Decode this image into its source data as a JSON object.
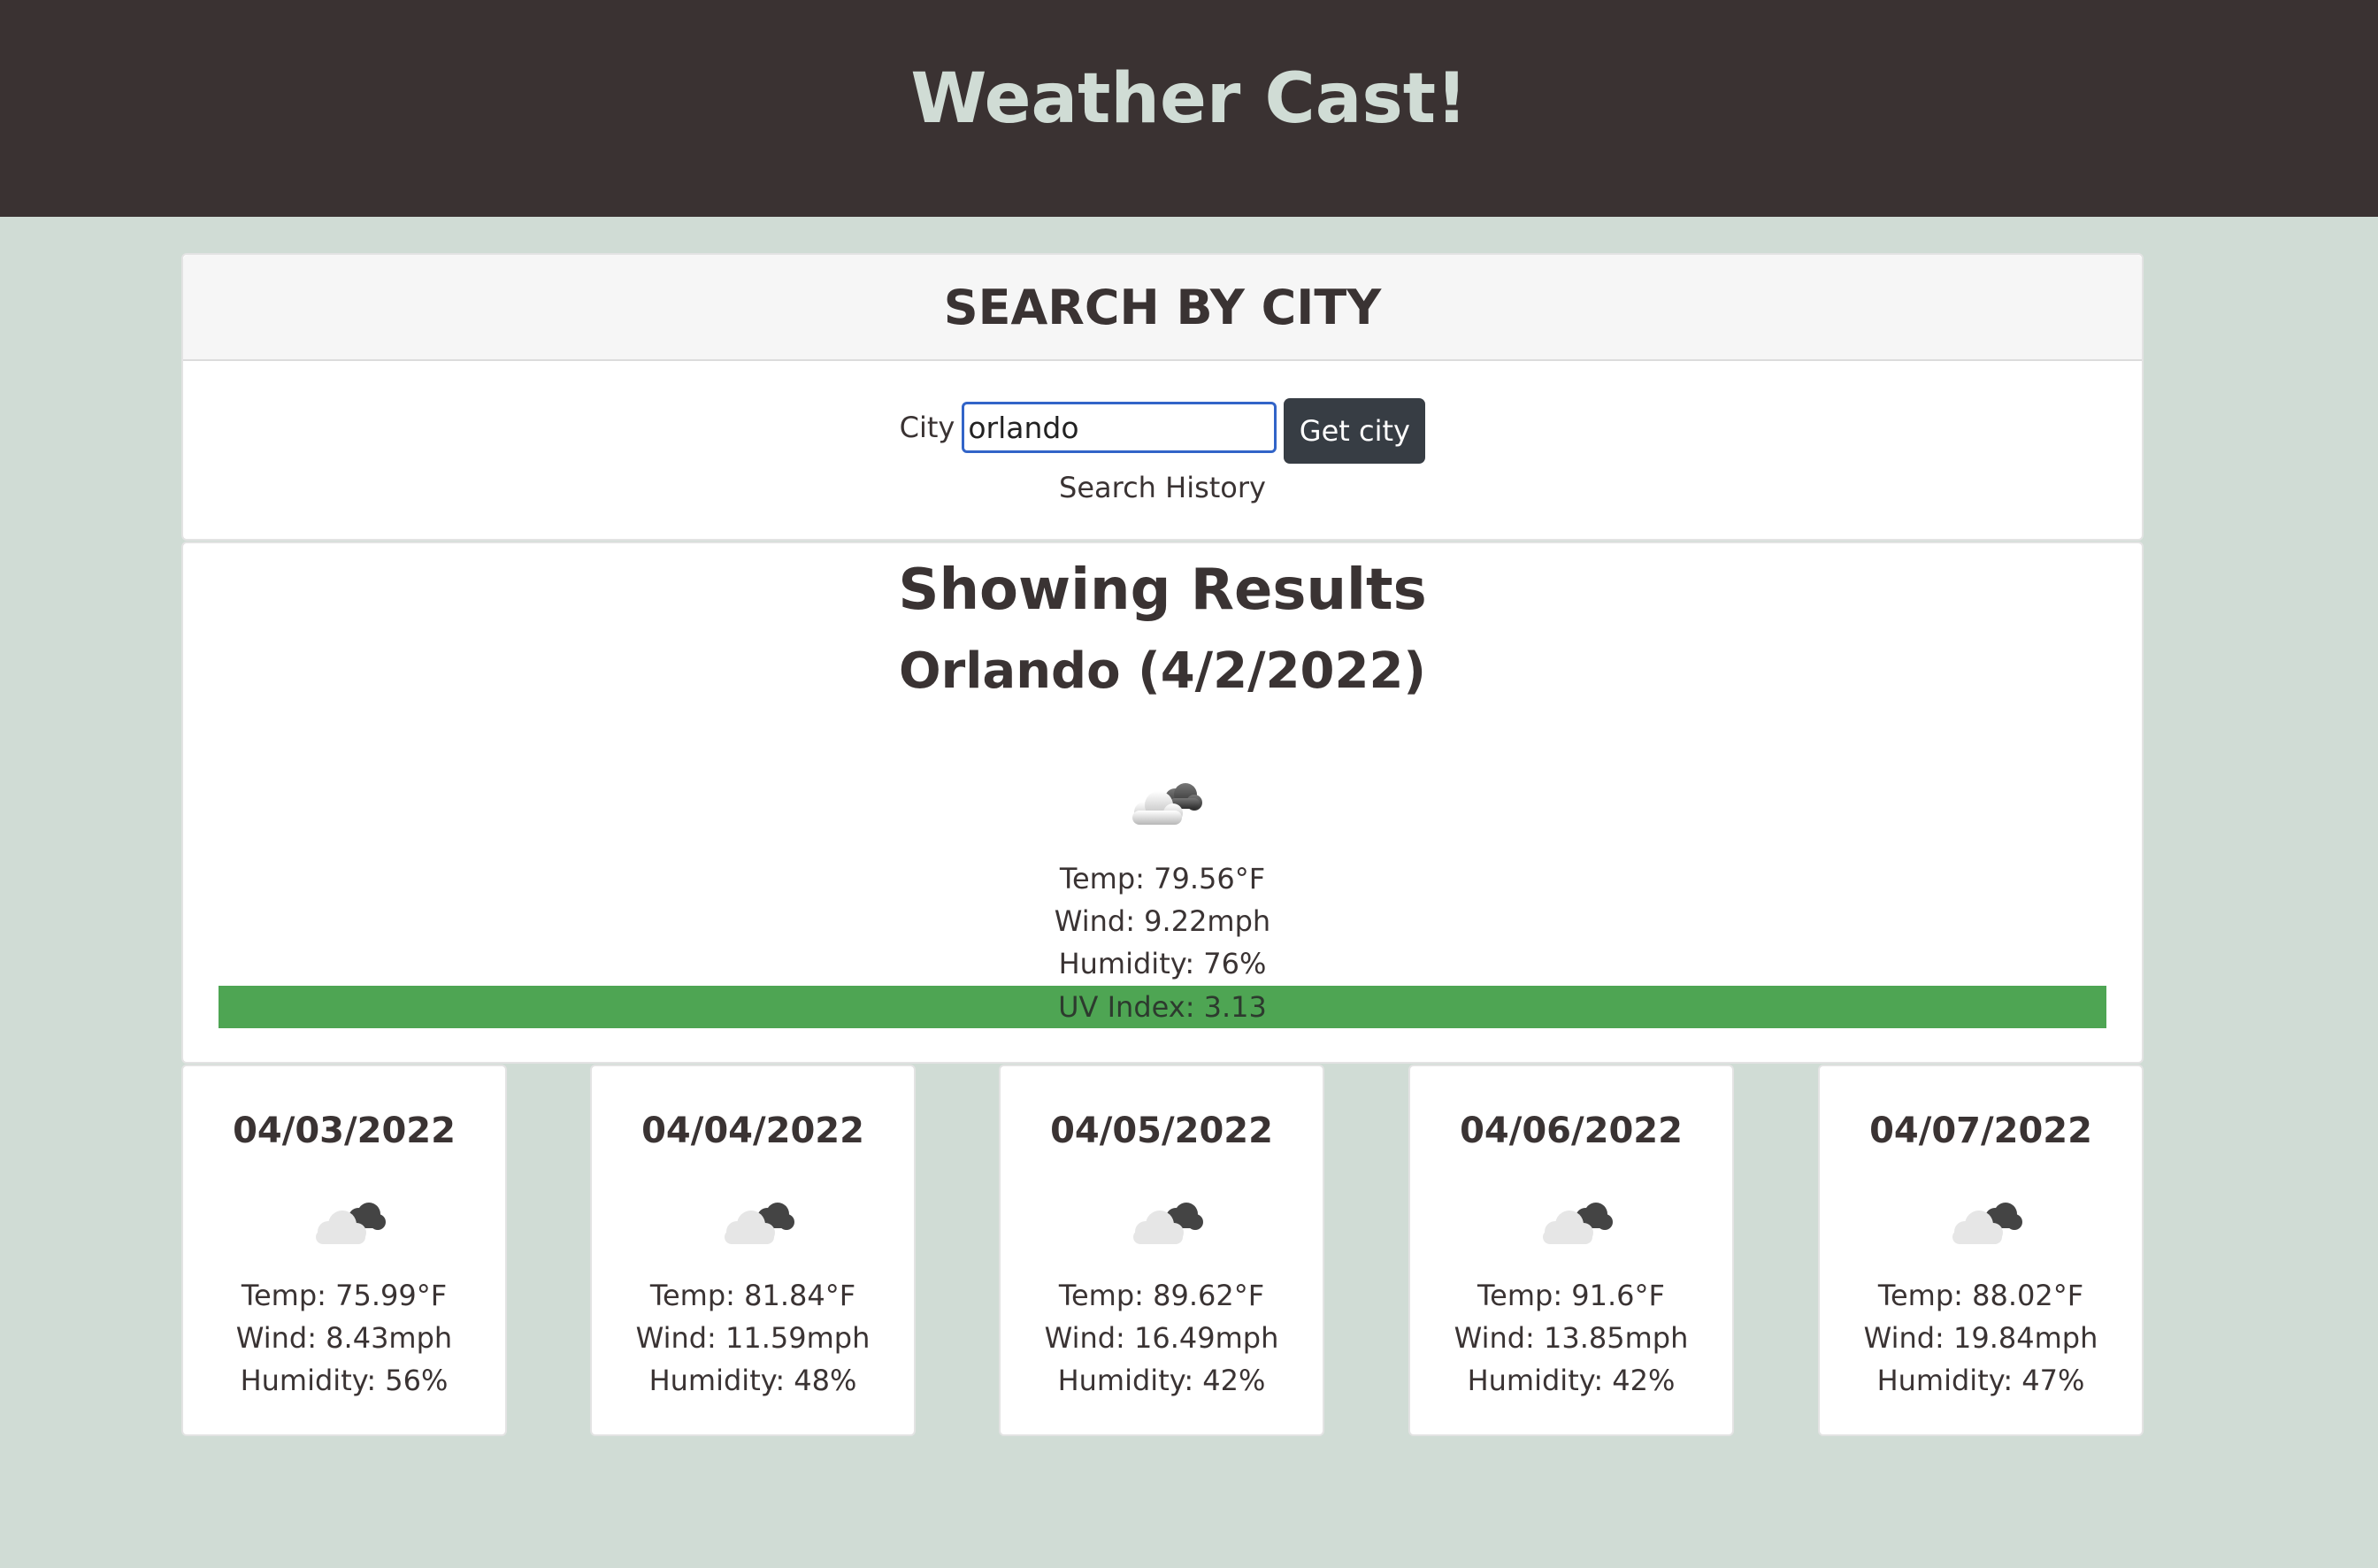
{
  "app": {
    "title": "Weather Cast!"
  },
  "search": {
    "header": "SEARCH BY CITY",
    "city_label": "City",
    "city_value": "orlando",
    "button_label": "Get city",
    "history_label": "Search History"
  },
  "results": {
    "heading": "Showing Results",
    "city_date": "Orlando (4/2/2022)",
    "icon": "partly-cloudy-icon",
    "temp": "Temp: 79.56°F",
    "wind": "Wind: 9.22mph",
    "humidity": "Humidity: 76%",
    "uv": "UV Index: 3.13",
    "uv_color": "#4ea553"
  },
  "forecast": [
    {
      "date": "04/03/2022",
      "icon": "partly-cloudy-icon",
      "temp": "Temp: 75.99°F",
      "wind": "Wind: 8.43mph",
      "humidity": "Humidity: 56%"
    },
    {
      "date": "04/04/2022",
      "icon": "partly-cloudy-icon",
      "temp": "Temp: 81.84°F",
      "wind": "Wind: 11.59mph",
      "humidity": "Humidity: 48%"
    },
    {
      "date": "04/05/2022",
      "icon": "partly-cloudy-icon",
      "temp": "Temp: 89.62°F",
      "wind": "Wind: 16.49mph",
      "humidity": "Humidity: 42%"
    },
    {
      "date": "04/06/2022",
      "icon": "partly-cloudy-icon",
      "temp": "Temp: 91.6°F",
      "wind": "Wind: 13.85mph",
      "humidity": "Humidity: 42%"
    },
    {
      "date": "04/07/2022",
      "icon": "partly-cloudy-icon",
      "temp": "Temp: 88.02°F",
      "wind": "Wind: 19.84mph",
      "humidity": "Humidity: 47%"
    }
  ],
  "colors": {
    "header_bg": "#3a3232",
    "page_bg": "#d0dcd5",
    "title_text": "#d0dcd5",
    "button_bg": "#373d44",
    "input_border": "#3264c8"
  }
}
